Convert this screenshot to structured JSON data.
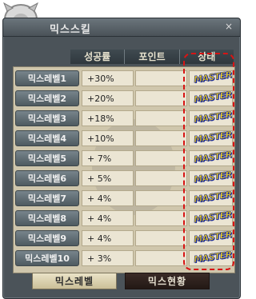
{
  "window": {
    "title": "믹스스킬",
    "close_icon": "×"
  },
  "header": {
    "columns": [
      "성공률",
      "포인트",
      "상태"
    ]
  },
  "rows": [
    {
      "label": "믹스레벨1",
      "rate": "+30%",
      "status": "MASTER"
    },
    {
      "label": "믹스레벨2",
      "rate": "+20%",
      "status": "MASTER"
    },
    {
      "label": "믹스레벨3",
      "rate": "+18%",
      "status": "MASTER"
    },
    {
      "label": "믹스레벨4",
      "rate": "+10%",
      "status": "MASTER"
    },
    {
      "label": "믹스레벨5",
      "rate": "+ 7%",
      "status": "MASTER"
    },
    {
      "label": "믹스레벨6",
      "rate": "+ 5%",
      "status": "MASTER"
    },
    {
      "label": "믹스레벨7",
      "rate": "+ 4%",
      "status": "MASTER"
    },
    {
      "label": "믹스레벨8",
      "rate": "+ 4%",
      "status": "MASTER"
    },
    {
      "label": "믹스레벨9",
      "rate": "+ 4%",
      "status": "MASTER"
    },
    {
      "label": "믹스레벨10",
      "rate": "+ 3%",
      "status": "MASTER"
    }
  ],
  "tabs": [
    {
      "label": "믹스레벨",
      "active": true
    },
    {
      "label": "믹스현황",
      "active": false
    }
  ],
  "colors": {
    "highlight": "#d81414",
    "master_fill": "#f3d21b",
    "master_outline": "#1a2a9a"
  }
}
